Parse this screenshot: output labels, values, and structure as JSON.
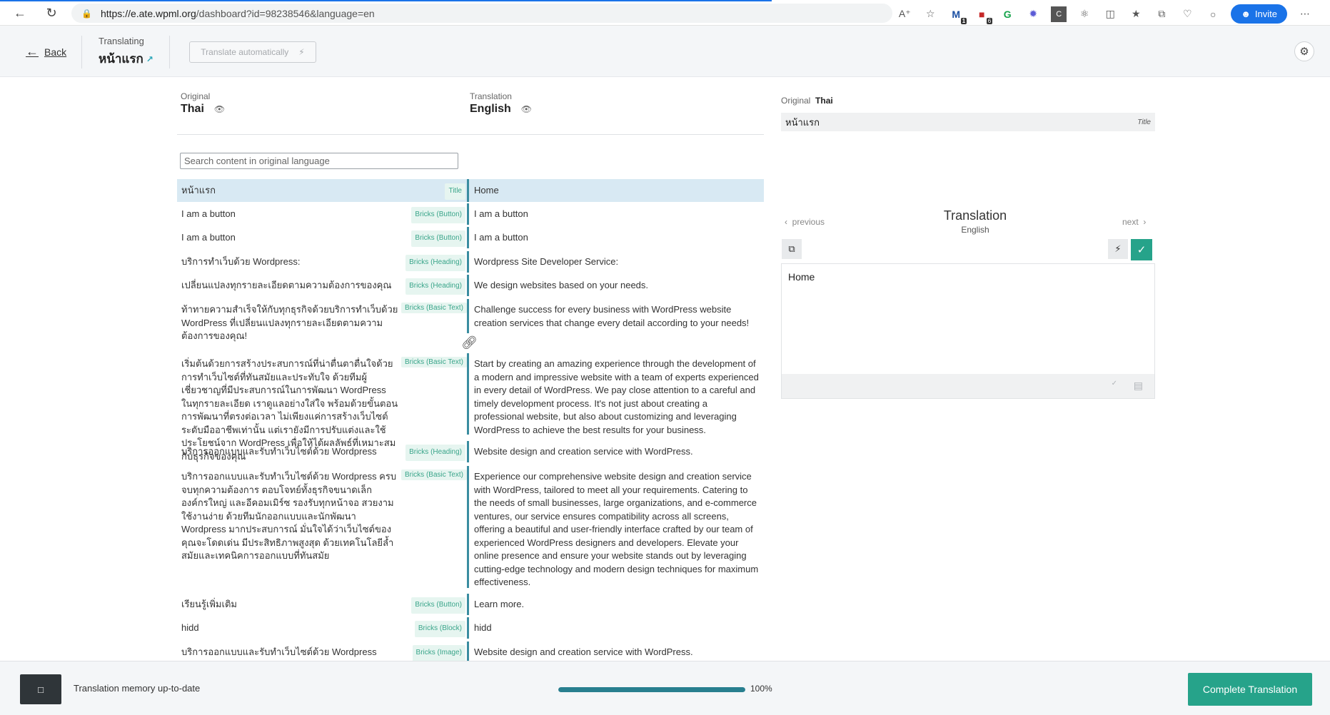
{
  "browser": {
    "url_host": "https://e.ate.wpml.org",
    "url_path": "/dashboard?id=98238546&language=en",
    "extension_badges": {
      "mail": "1",
      "calendar": "6"
    },
    "invite_label": "Invite",
    "load_progress": 0.58
  },
  "header": {
    "back_label": "Back",
    "translating_label": "Translating",
    "page_title": "หน้าแรก",
    "auto_translate_label": "Translate automatically"
  },
  "languages": {
    "original_label": "Original",
    "original_name": "Thai",
    "translation_label": "Translation",
    "translation_name": "English"
  },
  "search": {
    "placeholder": "Search content in original language"
  },
  "segments": [
    {
      "source": "หน้าแรก",
      "tag": "Title",
      "translation": "Home"
    },
    {
      "source": "I am a button",
      "tag": "Bricks (Button)",
      "translation": "I am a button"
    },
    {
      "source": "I am a button",
      "tag": "Bricks (Button)",
      "translation": "I am a button"
    },
    {
      "source": "บริการทำเว็บด้วย Wordpress:",
      "tag": "Bricks (Heading)",
      "translation": "Wordpress Site Developer Service:"
    },
    {
      "source": "เปลี่ยนแปลงทุกรายละเอียดตามความต้องการของคุณ",
      "tag": "Bricks (Heading)",
      "translation": "We design websites based on your needs."
    },
    {
      "source": "ท้าทายความสำเร็จให้กับทุกธุรกิจด้วยบริการทำเว็บด้วย WordPress ที่เปลี่ยนแปลงทุกรายละเอียดตามความต้องการของคุณ!",
      "tag": "Bricks (Basic Text)",
      "translation": "Challenge success for every business with WordPress website creation services that change every detail according to your needs!"
    },
    {
      "source": "เริ่มต้นด้วยการสร้างประสบการณ์ที่น่าตื่นตาตื่นใจด้วยการทำเว็บไซต์ที่ทันสมัยและประทับใจ ด้วยทีมผู้เชี่ยวชาญที่มีประสบการณ์ในการพัฒนา WordPress ในทุกรายละเอียด เราดูแลอย่างใส่ใจ พร้อมด้วยขั้นตอนการพัฒนาที่ตรงต่อเวลา ไม่เพียงแค่การสร้างเว็บไซต์ระดับมืออาชีพเท่านั้น แต่เรายังมีการปรับแต่งและใช้ประโยชน์จาก WordPress เพื่อให้ได้ผลลัพธ์ที่เหมาะสมกับธุรกิจของคุณ",
      "tag": "Bricks (Basic Text)",
      "translation": "Start by creating an amazing experience through the development of a modern and impressive website with a team of experts experienced in every detail of WordPress. We pay close attention to a careful and timely development process. It's not just about creating a professional website, but also about customizing and leveraging WordPress to achieve the best results for your business."
    },
    {
      "source": "บริการออกแบบและรับทำเว็บไซต์ด้วย Wordpress",
      "tag": "Bricks (Heading)",
      "translation": "Website design and creation service with WordPress."
    },
    {
      "source": "บริการออกแบบและรับทำเว็บไซต์ด้วย Wordpress ครบจบทุกความต้องการ ตอบโจทย์ทั้งธุรกิจขนาดเล็ก องค์กรใหญ่ และอีคอมเมิร์ซ รองรับทุกหน้าจอ สวยงาม ใช้งานง่าย ด้วยทีมนักออกแบบและนักพัฒนา Wordpress มากประสบการณ์ มั่นใจได้ว่าเว็บไซต์ของคุณจะโดดเด่น มีประสิทธิภาพสูงสุด ด้วยเทคโนโลยีล้ำสมัยและเทคนิคการออกแบบที่ทันสมัย",
      "tag": "Bricks (Basic Text)",
      "translation": "Experience our comprehensive website design and creation service with WordPress, tailored to meet all your requirements. Catering to the needs of small businesses, large organizations, and e-commerce ventures, our service ensures compatibility across all screens, offering a beautiful and user-friendly interface crafted by our team of experienced WordPress designers and developers. Elevate your online presence and ensure your website stands out by leveraging cutting-edge technology and modern design techniques for maximum effectiveness."
    },
    {
      "source": "เรียนรู้เพิ่มเติม",
      "tag": "Bricks (Button)",
      "translation": "Learn more."
    },
    {
      "source": "hidd",
      "tag": "Bricks (Block)",
      "translation": "hidd"
    },
    {
      "source": "บริการออกแบบและรับทำเว็บไซต์ด้วย Wordpress",
      "tag": "Bricks (Image)",
      "translation": "Website design and creation service with WordPress."
    }
  ],
  "panel": {
    "original_label": "Original",
    "original_lang": "Thai",
    "source_text": "หน้าแรก",
    "source_tag": "Title",
    "previous_label": "previous",
    "next_label": "next",
    "title": "Translation",
    "subtitle": "English",
    "editor_text": "Home"
  },
  "footer": {
    "memory_status": "Translation memory up-to-date",
    "progress_pct": 100,
    "progress_text": "100%",
    "complete_label": "Complete Translation"
  }
}
